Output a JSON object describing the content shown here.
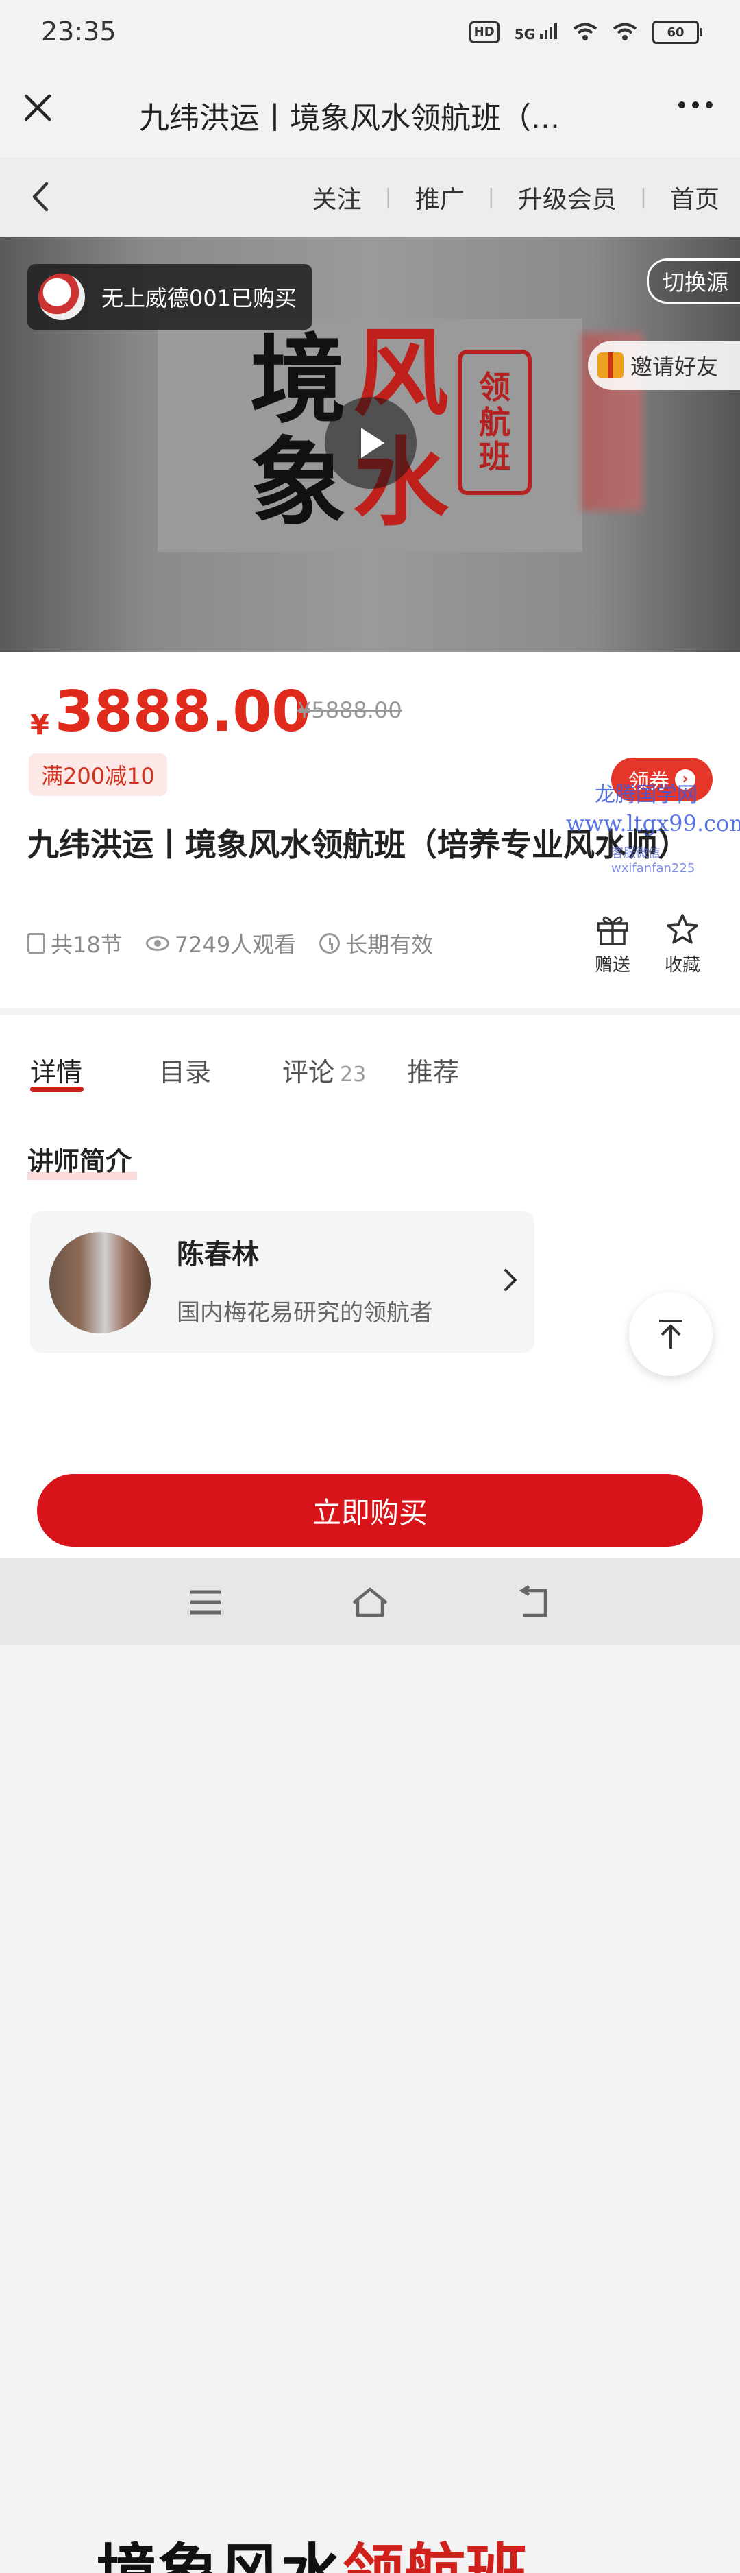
{
  "status_bar": {
    "time": "23:35",
    "hd": "HD",
    "network": "5G",
    "battery": "60"
  },
  "title_bar": {
    "title": "九纬洪运丨境象风水领航班（..."
  },
  "nav": {
    "links": [
      "关注",
      "推广",
      "升级会员",
      "首页"
    ]
  },
  "video": {
    "buyer_text": "无上威德001已购买",
    "switch_source": "切换源",
    "invite_friends": "邀请好友",
    "cover_chars": [
      "境",
      "象",
      "风",
      "水"
    ],
    "seal_chars": [
      "领",
      "航",
      "班"
    ]
  },
  "product": {
    "currency": "¥",
    "price": "3888.00",
    "original_price": "¥5888.00",
    "promo": "满200减10",
    "coupon_label": "领券",
    "title": "九纬洪运丨境象风水领航班（培养专业风水师）",
    "meta": {
      "sections": "共18节",
      "views": "7249人观看",
      "validity": "长期有效"
    },
    "actions": {
      "gift": "赠送",
      "favorite": "收藏"
    }
  },
  "watermark": {
    "line1": "龙腾国学网",
    "line2": "www.ltgx99.com",
    "line3": "客服微信 wxifanfan225"
  },
  "tabs": [
    {
      "label": "详情",
      "count": ""
    },
    {
      "label": "目录",
      "count": ""
    },
    {
      "label": "评论",
      "count": "23"
    },
    {
      "label": "推荐",
      "count": ""
    }
  ],
  "lecturer": {
    "section_title": "讲师简介",
    "name": "陈春林",
    "description": "国内梅花易研究的领航者"
  },
  "poster": {
    "black_text": "境象风水",
    "red_text": "领航班"
  },
  "buy": {
    "label": "立即购买"
  },
  "colors": {
    "accent": "#d8141a",
    "price": "#e02a1c"
  }
}
